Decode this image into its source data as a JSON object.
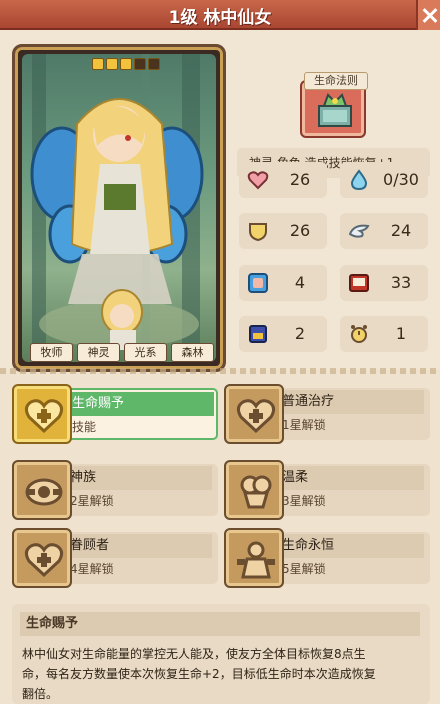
{
  "header": {
    "title": "1级 林中仙女"
  },
  "card": {
    "stars_filled": 3,
    "stars_total": 5,
    "tags": [
      "牧师",
      "神灵",
      "光系",
      "森林"
    ]
  },
  "law": {
    "label": "生命法则"
  },
  "description": "神灵 角色 造成技能恢复+1。",
  "stats": {
    "hp": "26",
    "mana": "0/30",
    "shield": "26",
    "wing": "24",
    "fist": "4",
    "book": "33",
    "potion": "2",
    "clock": "1"
  },
  "skills": [
    {
      "name": "生命赐予",
      "sub": "技能",
      "active": true,
      "icon": "heart-plus-icon"
    },
    {
      "name": "普通治疗",
      "sub": "1星解锁",
      "active": false,
      "icon": "heart-plus-icon"
    },
    {
      "name": "神族",
      "sub": "2星解锁",
      "active": false,
      "icon": "eye-emblem-icon"
    },
    {
      "name": "温柔",
      "sub": "3星解锁",
      "active": false,
      "icon": "clasp-icon"
    },
    {
      "name": "眷顾者",
      "sub": "4星解锁",
      "active": false,
      "icon": "heart-plus-icon"
    },
    {
      "name": "生命永恒",
      "sub": "5星解锁",
      "active": false,
      "icon": "figure-icon"
    }
  ],
  "detail": {
    "title": "生命赐予",
    "lines": [
      "林中仙女对生命能量的掌控无人能及，使友方全体目标恢复8点生",
      "命，每名友方数量使本次恢复生命+2，目标低生命时本次造成恢复",
      "翻倍。"
    ]
  },
  "colors": {
    "accent": "#c9674a",
    "active": "#5fb86a",
    "gold": "#e2b33a"
  }
}
